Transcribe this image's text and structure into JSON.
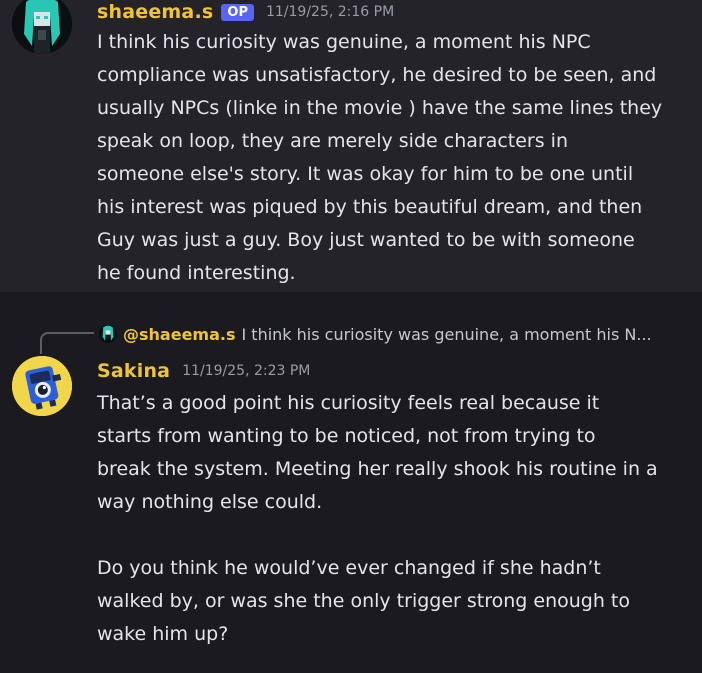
{
  "message1": {
    "username": "shaeema.s",
    "badge": "OP",
    "timestamp": "11/19/25, 2:16 PM",
    "lines": [
      "I think his curiosity was genuine, a moment his NPC",
      "compliance was unsatisfactory, he desired to be seen, and",
      "usually NPCs (linke in the movie ) have the same lines they",
      "speak on loop, they are merely side characters in",
      "someone else's story. It was okay for him to be one until",
      "his interest was piqued by this beautiful dream, and then",
      "Guy was just a guy. Boy just wanted to be with someone",
      "he found interesting."
    ]
  },
  "reply_preview": {
    "mention": "@shaeema.s",
    "snippet": "I think his curiosity was genuine, a moment his N..."
  },
  "message2": {
    "username": "Sakina",
    "timestamp": "11/19/25, 2:23 PM",
    "paragraph1": [
      "That’s a good point his curiosity feels real because it",
      "starts from wanting to be noticed, not from trying to",
      "break the system. Meeting her really shook his routine in a",
      "way nothing else could."
    ],
    "paragraph2": [
      "Do you think he would’ve ever changed if she hadn’t",
      "walked by, or was she the only trigger strong enough to",
      "wake him up?"
    ]
  },
  "colors": {
    "username": "#f0c33c",
    "op_badge": "#5865f2",
    "background": "#1b1b1f",
    "highlight_background": "#232328"
  },
  "icons": {
    "avatar1": "teal-haired-character-avatar",
    "avatar2": "blue-robot-camera-avatar"
  }
}
